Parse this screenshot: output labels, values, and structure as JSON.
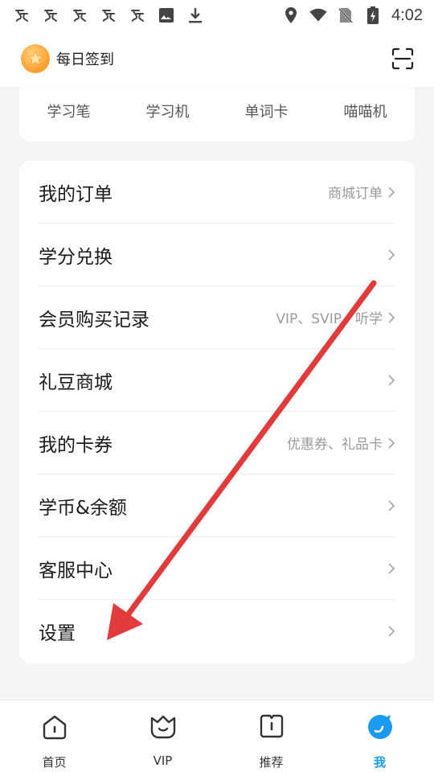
{
  "status_bar": {
    "time": "4:02",
    "left_icons": [
      "app-notification-icon",
      "app-notification-icon",
      "app-notification-icon",
      "app-notification-icon",
      "app-notification-icon",
      "image-icon",
      "download-icon"
    ],
    "right_icons": [
      "location-icon",
      "wifi-icon",
      "no-sim-icon",
      "battery-charging-icon"
    ]
  },
  "header": {
    "signin_label": "每日签到"
  },
  "categories": [
    "学习笔",
    "学习机",
    "单词卡",
    "喵喵机"
  ],
  "menu": [
    {
      "label": "我的订单",
      "hint": "商城订单"
    },
    {
      "label": "学分兑换",
      "hint": ""
    },
    {
      "label": "会员购买记录",
      "hint": "VIP、SVIP、听学"
    },
    {
      "label": "礼豆商城",
      "hint": ""
    },
    {
      "label": "我的卡券",
      "hint": "优惠券、礼品卡"
    },
    {
      "label": "学币&余额",
      "hint": ""
    },
    {
      "label": "客服中心",
      "hint": ""
    },
    {
      "label": "设置",
      "hint": ""
    }
  ],
  "bottom_nav": [
    {
      "label": "首页",
      "icon": "home-icon",
      "active": false
    },
    {
      "label": "VIP",
      "icon": "vip-crown-icon",
      "active": false
    },
    {
      "label": "推荐",
      "icon": "recommend-book-icon",
      "active": false
    },
    {
      "label": "我",
      "icon": "profile-icon",
      "active": true
    }
  ],
  "colors": {
    "accent": "#1a9bf0",
    "annotation_arrow": "#e23b3b",
    "background": "#f4f5f7"
  }
}
